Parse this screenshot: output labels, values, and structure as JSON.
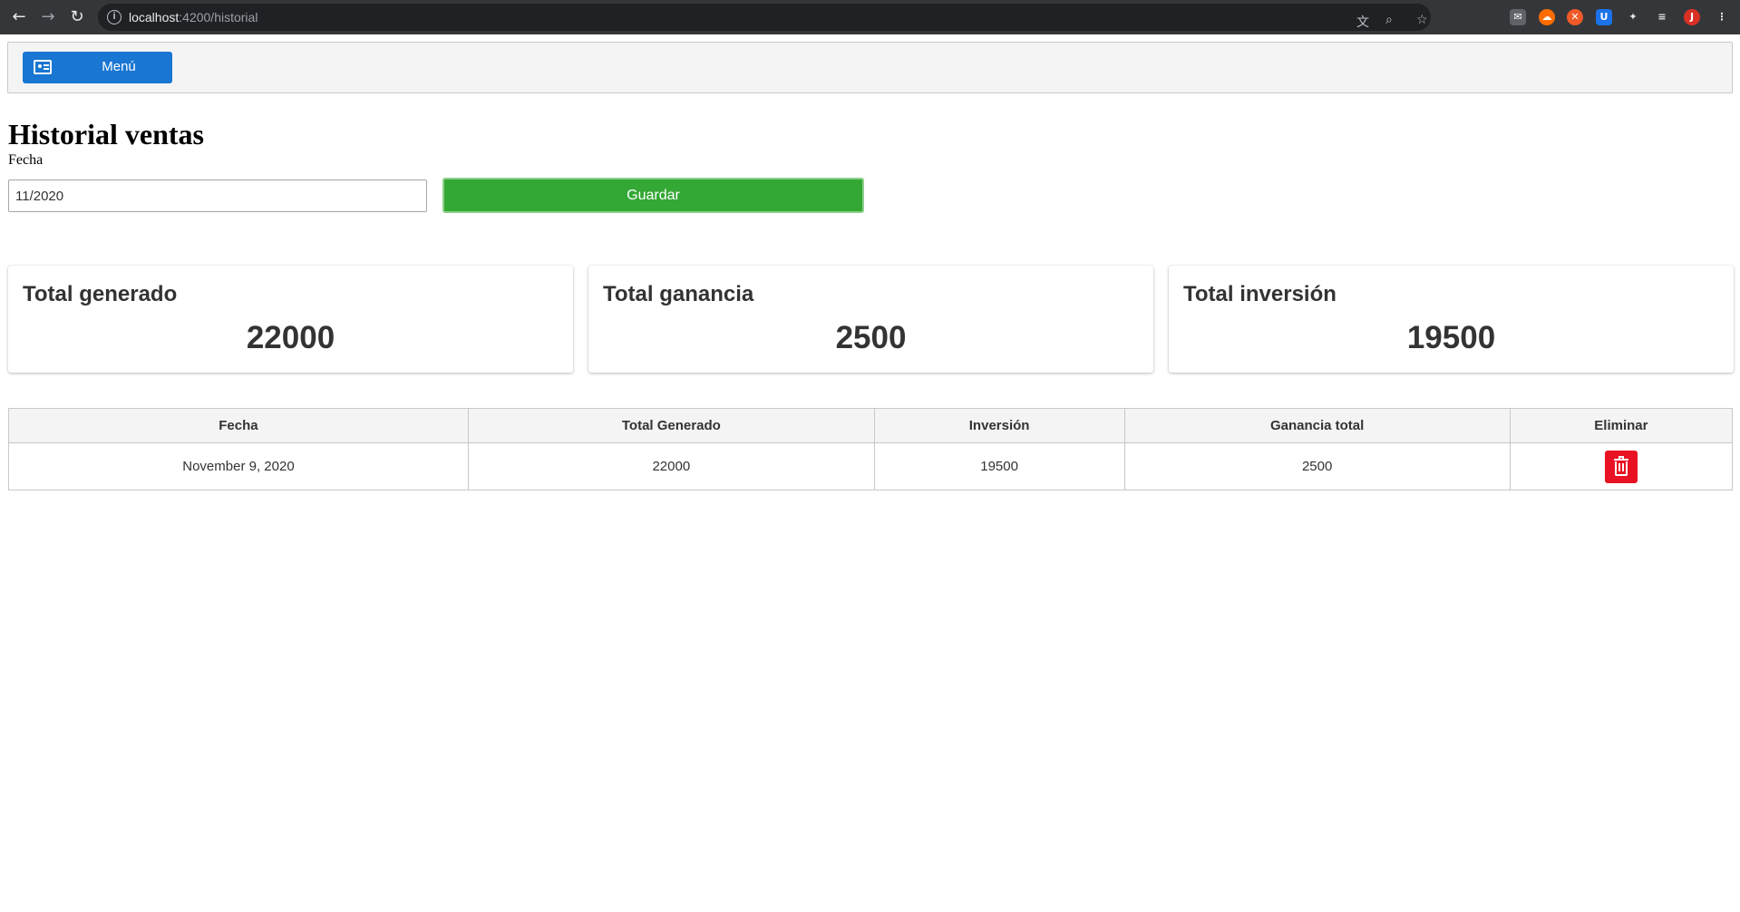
{
  "browser": {
    "url_host": "localhost",
    "url_rest": ":4200/historial",
    "profile_initial": "J"
  },
  "menubar": {
    "menu_label": "Menú"
  },
  "page": {
    "title": "Historial ventas",
    "date_label": "Fecha",
    "date_value": "11/2020",
    "save_label": "Guardar"
  },
  "cards": [
    {
      "title": "Total generado",
      "value": "22000"
    },
    {
      "title": "Total ganancia",
      "value": "2500"
    },
    {
      "title": "Total inversión",
      "value": "19500"
    }
  ],
  "table": {
    "headers": [
      "Fecha",
      "Total Generado",
      "Inversión",
      "Ganancia total",
      "Eliminar"
    ],
    "rows": [
      [
        "November 9, 2020",
        "22000",
        "19500",
        "2500"
      ]
    ]
  },
  "colors": {
    "menu_button": "#1976d2",
    "save_button": "#34a835",
    "delete_button": "#e91224"
  }
}
